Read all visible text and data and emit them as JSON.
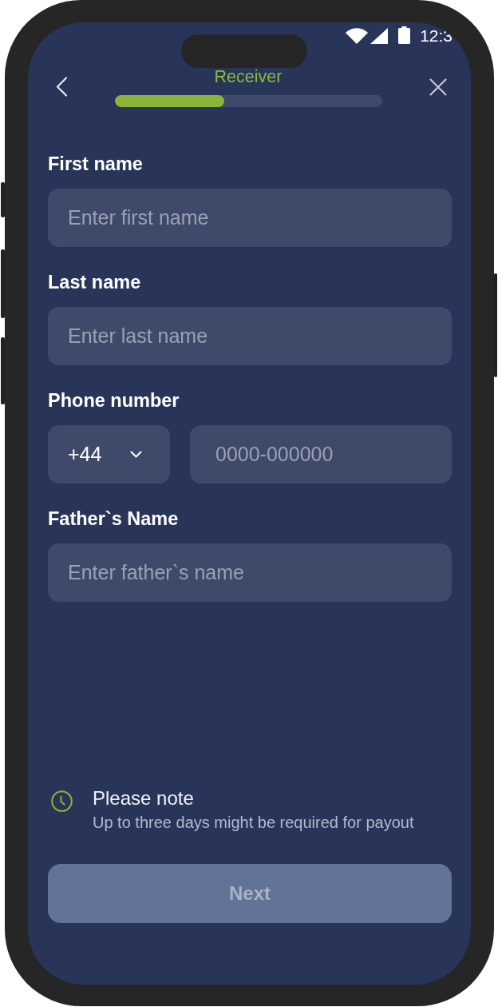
{
  "status_bar": {
    "time": "12:3"
  },
  "header": {
    "title": "Receiver",
    "progress": {
      "level": 0.41
    }
  },
  "fields": [
    {
      "kind": "text",
      "label": "First name",
      "placeholder": "Enter first name"
    },
    {
      "kind": "text",
      "label": "Last name",
      "placeholder": "Enter last name"
    },
    {
      "kind": "phone",
      "label": "Phone number",
      "country_code": "+44",
      "placeholder": "0000-000000"
    },
    {
      "kind": "text",
      "label": "Father`s Name",
      "placeholder": "Enter father`s name"
    }
  ],
  "note": {
    "title": "Please note",
    "text": "Up to three days might be required for payout"
  },
  "next_button": {
    "label": "Next",
    "disabled": true
  }
}
